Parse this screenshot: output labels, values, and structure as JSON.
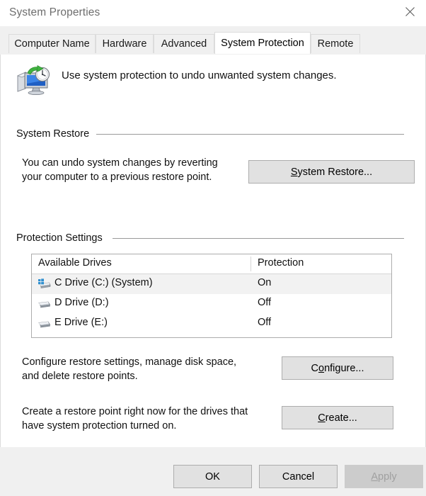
{
  "window": {
    "title": "System Properties",
    "close_icon": "close-icon"
  },
  "tabs": [
    {
      "label": "Computer Name",
      "active": false
    },
    {
      "label": "Hardware",
      "active": false
    },
    {
      "label": "Advanced",
      "active": false
    },
    {
      "label": "System Protection",
      "active": true
    },
    {
      "label": "Remote",
      "active": false
    }
  ],
  "header": {
    "icon": "system-protection-icon",
    "caption": "Use system protection to undo unwanted system changes."
  },
  "system_restore": {
    "group_label": "System Restore",
    "description": "You can undo system changes by reverting\nyour computer to a previous restore point.",
    "button": {
      "accel": "S",
      "rest": "ystem Restore...",
      "full_label": "System Restore..."
    }
  },
  "protection_settings": {
    "group_label": "Protection Settings",
    "columns": [
      "Available Drives",
      "Protection"
    ],
    "rows": [
      {
        "icon": "system-drive-icon",
        "name": "C Drive (C:) (System)",
        "protection": "On",
        "selected": true
      },
      {
        "icon": "drive-icon",
        "name": "D Drive (D:)",
        "protection": "Off",
        "selected": false
      },
      {
        "icon": "drive-icon",
        "name": "E Drive (E:)",
        "protection": "Off",
        "selected": false
      }
    ],
    "configure": {
      "description": "Configure restore settings, manage disk space,\nand delete restore points.",
      "button": {
        "pre": "C",
        "accel": "o",
        "rest": "nfigure...",
        "full_label": "Configure..."
      }
    },
    "create": {
      "description": "Create a restore point right now for the drives that\nhave system protection turned on.",
      "button": {
        "pre": "",
        "accel": "C",
        "rest": "reate...",
        "full_label": "Create..."
      }
    }
  },
  "footer": {
    "ok": {
      "label": "OK",
      "enabled": true
    },
    "cancel": {
      "label": "Cancel",
      "enabled": true
    },
    "apply": {
      "accel": "A",
      "rest": "pply",
      "full_label": "Apply",
      "enabled": false
    }
  },
  "colors": {
    "dialog_face": "#f0f0f0",
    "page_bg": "#ffffff",
    "button_face": "#e1e1e1",
    "button_border": "#adadad",
    "button_disabled_face": "#cccccc",
    "button_disabled_text": "#a0a0a0",
    "title_text": "#6e6e6e",
    "body_text": "#111111",
    "rule": "#9a9a9a",
    "selection": "#f2f2f2"
  }
}
